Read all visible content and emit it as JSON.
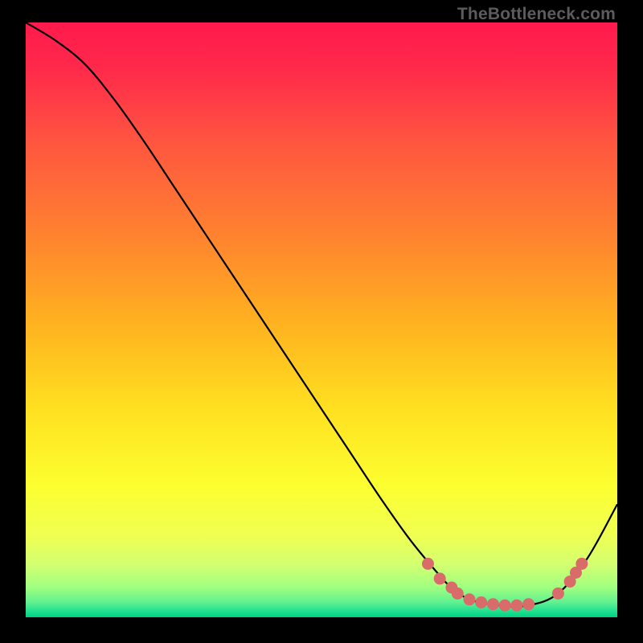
{
  "watermark": "TheBottleneck.com",
  "chart_data": {
    "type": "line",
    "title": "",
    "xlabel": "",
    "ylabel": "",
    "xlim": [
      0,
      100
    ],
    "ylim": [
      0,
      100
    ],
    "legend": null,
    "grid": false,
    "curve": {
      "x": [
        0,
        5,
        10,
        15,
        20,
        25,
        30,
        35,
        40,
        45,
        50,
        55,
        60,
        65,
        70,
        72,
        75,
        80,
        85,
        90,
        95,
        100
      ],
      "y": [
        100,
        97,
        93,
        87,
        80,
        72.5,
        65,
        57.5,
        50,
        42.5,
        35,
        27.5,
        20,
        13,
        7,
        5,
        3,
        2,
        2,
        4,
        10,
        19
      ]
    },
    "markers": {
      "color": "#d96b6b",
      "points": [
        {
          "x": 68,
          "y": 9
        },
        {
          "x": 70,
          "y": 6.5
        },
        {
          "x": 72,
          "y": 5
        },
        {
          "x": 73,
          "y": 4
        },
        {
          "x": 75,
          "y": 3
        },
        {
          "x": 77,
          "y": 2.5
        },
        {
          "x": 79,
          "y": 2.2
        },
        {
          "x": 81,
          "y": 2
        },
        {
          "x": 83,
          "y": 2
        },
        {
          "x": 85,
          "y": 2.2
        },
        {
          "x": 90,
          "y": 4
        },
        {
          "x": 92,
          "y": 6
        },
        {
          "x": 93,
          "y": 7.5
        },
        {
          "x": 94,
          "y": 9
        }
      ]
    },
    "gradient_stops": [
      {
        "offset": 0,
        "color": "#ff1a4d"
      },
      {
        "offset": 0.08,
        "color": "#ff2a4a"
      },
      {
        "offset": 0.2,
        "color": "#ff5540"
      },
      {
        "offset": 0.35,
        "color": "#ff8030"
      },
      {
        "offset": 0.5,
        "color": "#ffb020"
      },
      {
        "offset": 0.65,
        "color": "#ffe020"
      },
      {
        "offset": 0.78,
        "color": "#fcff30"
      },
      {
        "offset": 0.86,
        "color": "#f0ff50"
      },
      {
        "offset": 0.91,
        "color": "#d4ff70"
      },
      {
        "offset": 0.95,
        "color": "#a0ff80"
      },
      {
        "offset": 0.975,
        "color": "#60f090"
      },
      {
        "offset": 0.99,
        "color": "#20e090"
      },
      {
        "offset": 1.0,
        "color": "#00d080"
      }
    ]
  }
}
